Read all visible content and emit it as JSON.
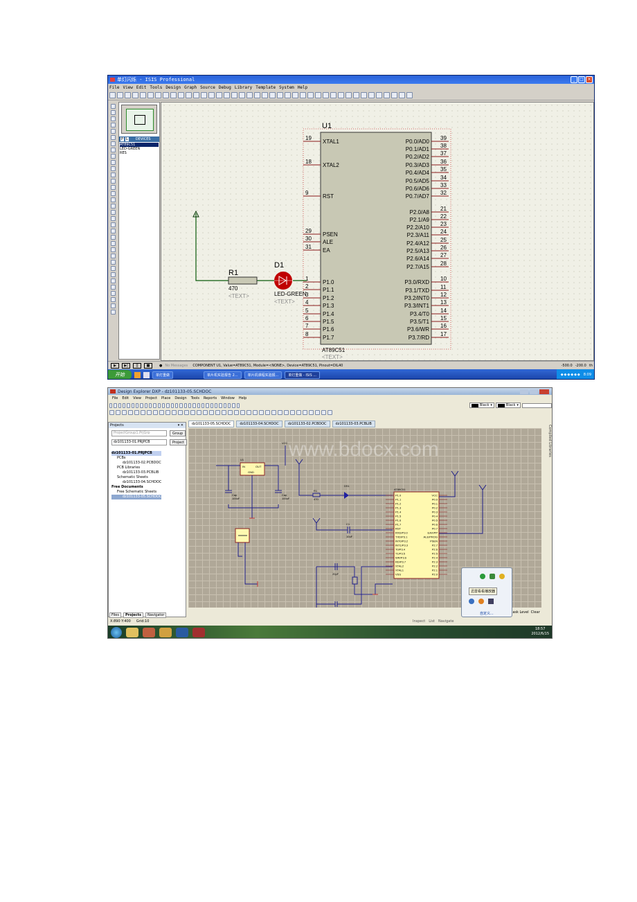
{
  "isis": {
    "title": "单灯闪烁 - ISIS Professional",
    "menu": [
      "File",
      "View",
      "Edit",
      "Tools",
      "Design",
      "Graph",
      "Source",
      "Debug",
      "Library",
      "Template",
      "System",
      "Help"
    ],
    "panel_tabs": [
      "P",
      "L",
      "DEVICES"
    ],
    "devices": [
      "AT89C51",
      "LED-GREEN",
      "RES"
    ],
    "chip": {
      "ref": "U1",
      "part": "AT89C51",
      "text_placeholder": "<TEXT>",
      "left_pins": [
        {
          "num": "19",
          "name": "XTAL1"
        },
        {
          "num": "18",
          "name": "XTAL2"
        },
        {
          "num": "9",
          "name": "RST"
        },
        {
          "num": "29",
          "name": "PSEN"
        },
        {
          "num": "30",
          "name": "ALE"
        },
        {
          "num": "31",
          "name": "EA"
        },
        {
          "num": "1",
          "name": "P1.0"
        },
        {
          "num": "2",
          "name": "P1.1"
        },
        {
          "num": "3",
          "name": "P1.2"
        },
        {
          "num": "4",
          "name": "P1.3"
        },
        {
          "num": "5",
          "name": "P1.4"
        },
        {
          "num": "6",
          "name": "P1.5"
        },
        {
          "num": "7",
          "name": "P1.6"
        },
        {
          "num": "8",
          "name": "P1.7"
        }
      ],
      "right_pins": [
        {
          "num": "39",
          "name": "P0.0/AD0"
        },
        {
          "num": "38",
          "name": "P0.1/AD1"
        },
        {
          "num": "37",
          "name": "P0.2/AD2"
        },
        {
          "num": "36",
          "name": "P0.3/AD3"
        },
        {
          "num": "35",
          "name": "P0.4/AD4"
        },
        {
          "num": "34",
          "name": "P0.5/AD5"
        },
        {
          "num": "33",
          "name": "P0.6/AD6"
        },
        {
          "num": "32",
          "name": "P0.7/AD7"
        },
        {
          "num": "21",
          "name": "P2.0/A8"
        },
        {
          "num": "22",
          "name": "P2.1/A9"
        },
        {
          "num": "23",
          "name": "P2.2/A10"
        },
        {
          "num": "24",
          "name": "P2.3/A11"
        },
        {
          "num": "25",
          "name": "P2.4/A12"
        },
        {
          "num": "26",
          "name": "P2.5/A13"
        },
        {
          "num": "27",
          "name": "P2.6/A14"
        },
        {
          "num": "28",
          "name": "P2.7/A15"
        },
        {
          "num": "10",
          "name": "P3.0/RXD"
        },
        {
          "num": "11",
          "name": "P3.1/TXD"
        },
        {
          "num": "12",
          "name": "P3.2/INT0"
        },
        {
          "num": "13",
          "name": "P3.3/INT1"
        },
        {
          "num": "14",
          "name": "P3.4/T0"
        },
        {
          "num": "15",
          "name": "P3.5/T1"
        },
        {
          "num": "16",
          "name": "P3.6/WR"
        },
        {
          "num": "17",
          "name": "P3.7/RD"
        }
      ]
    },
    "r1": {
      "ref": "R1",
      "value": "470",
      "text": "<TEXT>"
    },
    "d1": {
      "ref": "D1",
      "value": "LED-GREEN",
      "text": "<TEXT>"
    },
    "status": {
      "messages": "No Messages",
      "component": "COMPONENT U1, Value=AT89C51, Module=<NONE>, Device=AT89C51, Pinout=DIL40",
      "x": "-500.0",
      "y": "-200.0",
      "unit": "th"
    },
    "taskbar": {
      "start": "开始",
      "tasks": [
        "单灯重做",
        "单片机实验报告 2...",
        "单片机课程实验报...",
        "单灯重做 - ISIS ..."
      ],
      "clock": "8:09"
    }
  },
  "dxp": {
    "title": "Design Explorer DXP - dz101133-05.SCHDOC",
    "menu": [
      "File",
      "Edit",
      "View",
      "Project",
      "Place",
      "Design",
      "Tools",
      "Reports",
      "Window",
      "Help"
    ],
    "color1": "Black",
    "color2": "Black",
    "tabs": [
      "dz101133-05.SCHDOC",
      "dz101133-04.SCHDOC",
      "dz101133-02.PCBDOC",
      "dz101133-03.PCBLIB"
    ],
    "projects_header": "Projects",
    "workspace": "ProjectGroup1.PrjGrp",
    "project": "dz101133-01.PRJPCB",
    "group_btn": "Group",
    "project_btn": "Project",
    "tree": [
      {
        "label": "dz101133-01.PRJPCB",
        "level": 0
      },
      {
        "label": "PCBs",
        "level": 1
      },
      {
        "label": "dz101133-02.PCBDOC",
        "level": 2
      },
      {
        "label": "PCB Libraries",
        "level": 1
      },
      {
        "label": "dz101133-03.PCBLIB",
        "level": 2
      },
      {
        "label": "Schematic Sheets",
        "level": 1
      },
      {
        "label": "dz101133-04.SCHDOC",
        "level": 2
      },
      {
        "label": "Free Documents",
        "level": 0
      },
      {
        "label": "Free Schematic Sheets",
        "level": 1
      },
      {
        "label": "dz101133-05.SCHDOC",
        "level": 2
      }
    ],
    "bottom_tabs": [
      "Files",
      "Projects",
      "Navigator"
    ],
    "status_coords": "X:890 Y:400",
    "status_grid": "Grid:10",
    "nav": [
      "Inspect",
      "List",
      "Navigate"
    ],
    "right_status": [
      "Mask Level",
      "Clear"
    ],
    "side_tab": "Compiled Libraries",
    "watermark": "www.bdocx.com",
    "popup_tip": "迅雷看看播放器",
    "popup_custom": "自定义...",
    "clock_time": "18:57",
    "clock_date": "2012/6/15",
    "schematic": {
      "vcc": "VCC",
      "reg_in": "IN",
      "reg_out": "OUT",
      "reg_gnd": "GND",
      "reg_ref": "U1",
      "cap": "Cap",
      "cap_val": "100uF",
      "r_ref": "R1",
      "r_val": "470",
      "led_ref": "DS1",
      "c_ref": "C1",
      "c_val": "10uF",
      "xtal_cap": "20pF",
      "chip_name": "AT89C51",
      "left_pins": [
        "P1.0",
        "P1.1",
        "P1.2",
        "P1.3",
        "P1.4",
        "P1.5",
        "P1.6",
        "P1.7",
        "RST",
        "RXD/P3.0",
        "TXD/P3.1",
        "INT0/P3.2",
        "INT1/P3.3",
        "T0/P3.4",
        "T1/P3.5",
        "WR/P3.6",
        "RD/P3.7",
        "XTAL2",
        "XTAL1",
        "VSS"
      ],
      "right_pins": [
        "VCC",
        "P0.0",
        "P0.1",
        "P0.2",
        "P0.3",
        "P0.4",
        "P0.5",
        "P0.6",
        "P0.7",
        "EA/VPP",
        "ALE/PROG",
        "PSEN",
        "P2.7",
        "P2.6",
        "P2.5",
        "P2.4",
        "P2.3",
        "P2.2",
        "P2.1",
        "P2.0"
      ]
    }
  }
}
